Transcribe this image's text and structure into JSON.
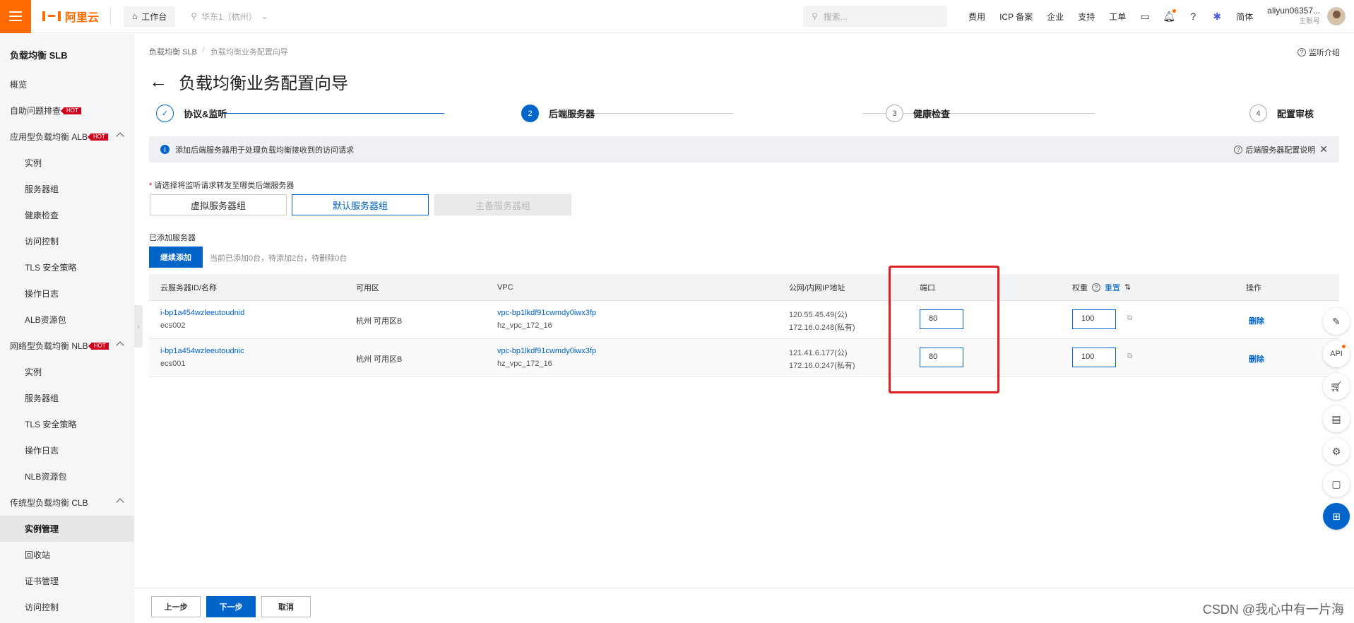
{
  "topbar": {
    "brand": "阿里云",
    "workbench": "工作台",
    "region": "华东1（杭州）",
    "search_placeholder": "搜索...",
    "links": [
      "费用",
      "ICP 备案",
      "企业",
      "支持",
      "工单"
    ],
    "lang": "简体",
    "user_name": "aliyun06357...",
    "user_sub": "主账号"
  },
  "sidebar": {
    "title": "负载均衡 SLB",
    "hot": "HOT",
    "items": [
      {
        "label": "概览"
      },
      {
        "label": "自助问题排查"
      },
      {
        "label": "应用型负载均衡 ALB"
      },
      {
        "label": "实例"
      },
      {
        "label": "服务器组"
      },
      {
        "label": "健康检查"
      },
      {
        "label": "访问控制"
      },
      {
        "label": "TLS 安全策略"
      },
      {
        "label": "操作日志"
      },
      {
        "label": "ALB资源包"
      },
      {
        "label": "网络型负载均衡 NLB"
      },
      {
        "label": "实例"
      },
      {
        "label": "服务器组"
      },
      {
        "label": "TLS 安全策略"
      },
      {
        "label": "操作日志"
      },
      {
        "label": "NLB资源包"
      },
      {
        "label": "传统型负载均衡 CLB"
      },
      {
        "label": "实例管理"
      },
      {
        "label": "回收站"
      },
      {
        "label": "证书管理"
      },
      {
        "label": "访问控制"
      }
    ]
  },
  "breadcrumb": [
    "负载均衡 SLB",
    "/",
    "负载均衡业务配置向导"
  ],
  "help_top": "监听介绍",
  "page_title": "负载均衡业务配置向导",
  "steps": [
    {
      "num": "✓",
      "label": "协议&监听"
    },
    {
      "num": "2",
      "label": "后端服务器"
    },
    {
      "num": "3",
      "label": "健康检查"
    },
    {
      "num": "4",
      "label": "配置审核"
    }
  ],
  "info": {
    "text": "添加后端服务器用于处理负载均衡接收到的访问请求",
    "right": "后端服务器配置说明"
  },
  "server_type": {
    "label": "请选择将监听请求转发至哪类后端服务器",
    "options": [
      "虚拟服务器组",
      "默认服务器组",
      "主备服务器组"
    ]
  },
  "added": {
    "label": "已添加服务器",
    "add_button": "继续添加",
    "counts": "当前已添加0台，待添加2台，待删除0台"
  },
  "table": {
    "headers": {
      "id": "云服务器ID/名称",
      "zone": "可用区",
      "vpc": "VPC",
      "ip": "公网/内网IP地址",
      "port": "端口",
      "weight": "权重",
      "reset": "重置",
      "action": "操作"
    },
    "rows": [
      {
        "id": "i-bp1a454wzleeutoudnid",
        "name": "ecs002",
        "zone": "杭州 可用区B",
        "vpc_id": "vpc-bp1lkdf91cwmdy0iwx3fp",
        "vpc_name": "hz_vpc_172_16",
        "ip_public": "120.55.45.49(公)",
        "ip_private": "172.16.0.248(私有)",
        "port": "80",
        "weight": "100",
        "action": "删除"
      },
      {
        "id": "i-bp1a454wzleeutoudnic",
        "name": "ecs001",
        "zone": "杭州 可用区B",
        "vpc_id": "vpc-bp1lkdf91cwmdy0iwx3fp",
        "vpc_name": "hz_vpc_172_16",
        "ip_public": "121.41.6.177(公)",
        "ip_private": "172.16.0.247(私有)",
        "port": "80",
        "weight": "100",
        "action": "删除"
      }
    ]
  },
  "footer": {
    "prev": "上一步",
    "next": "下一步",
    "cancel": "取消",
    "watermark": "CSDN @我心中有一片海"
  },
  "floatbar": {
    "api": "API"
  },
  "colors": {
    "brand": "#ff6a00",
    "primary": "#0064c8",
    "highlight": "#e02020"
  }
}
